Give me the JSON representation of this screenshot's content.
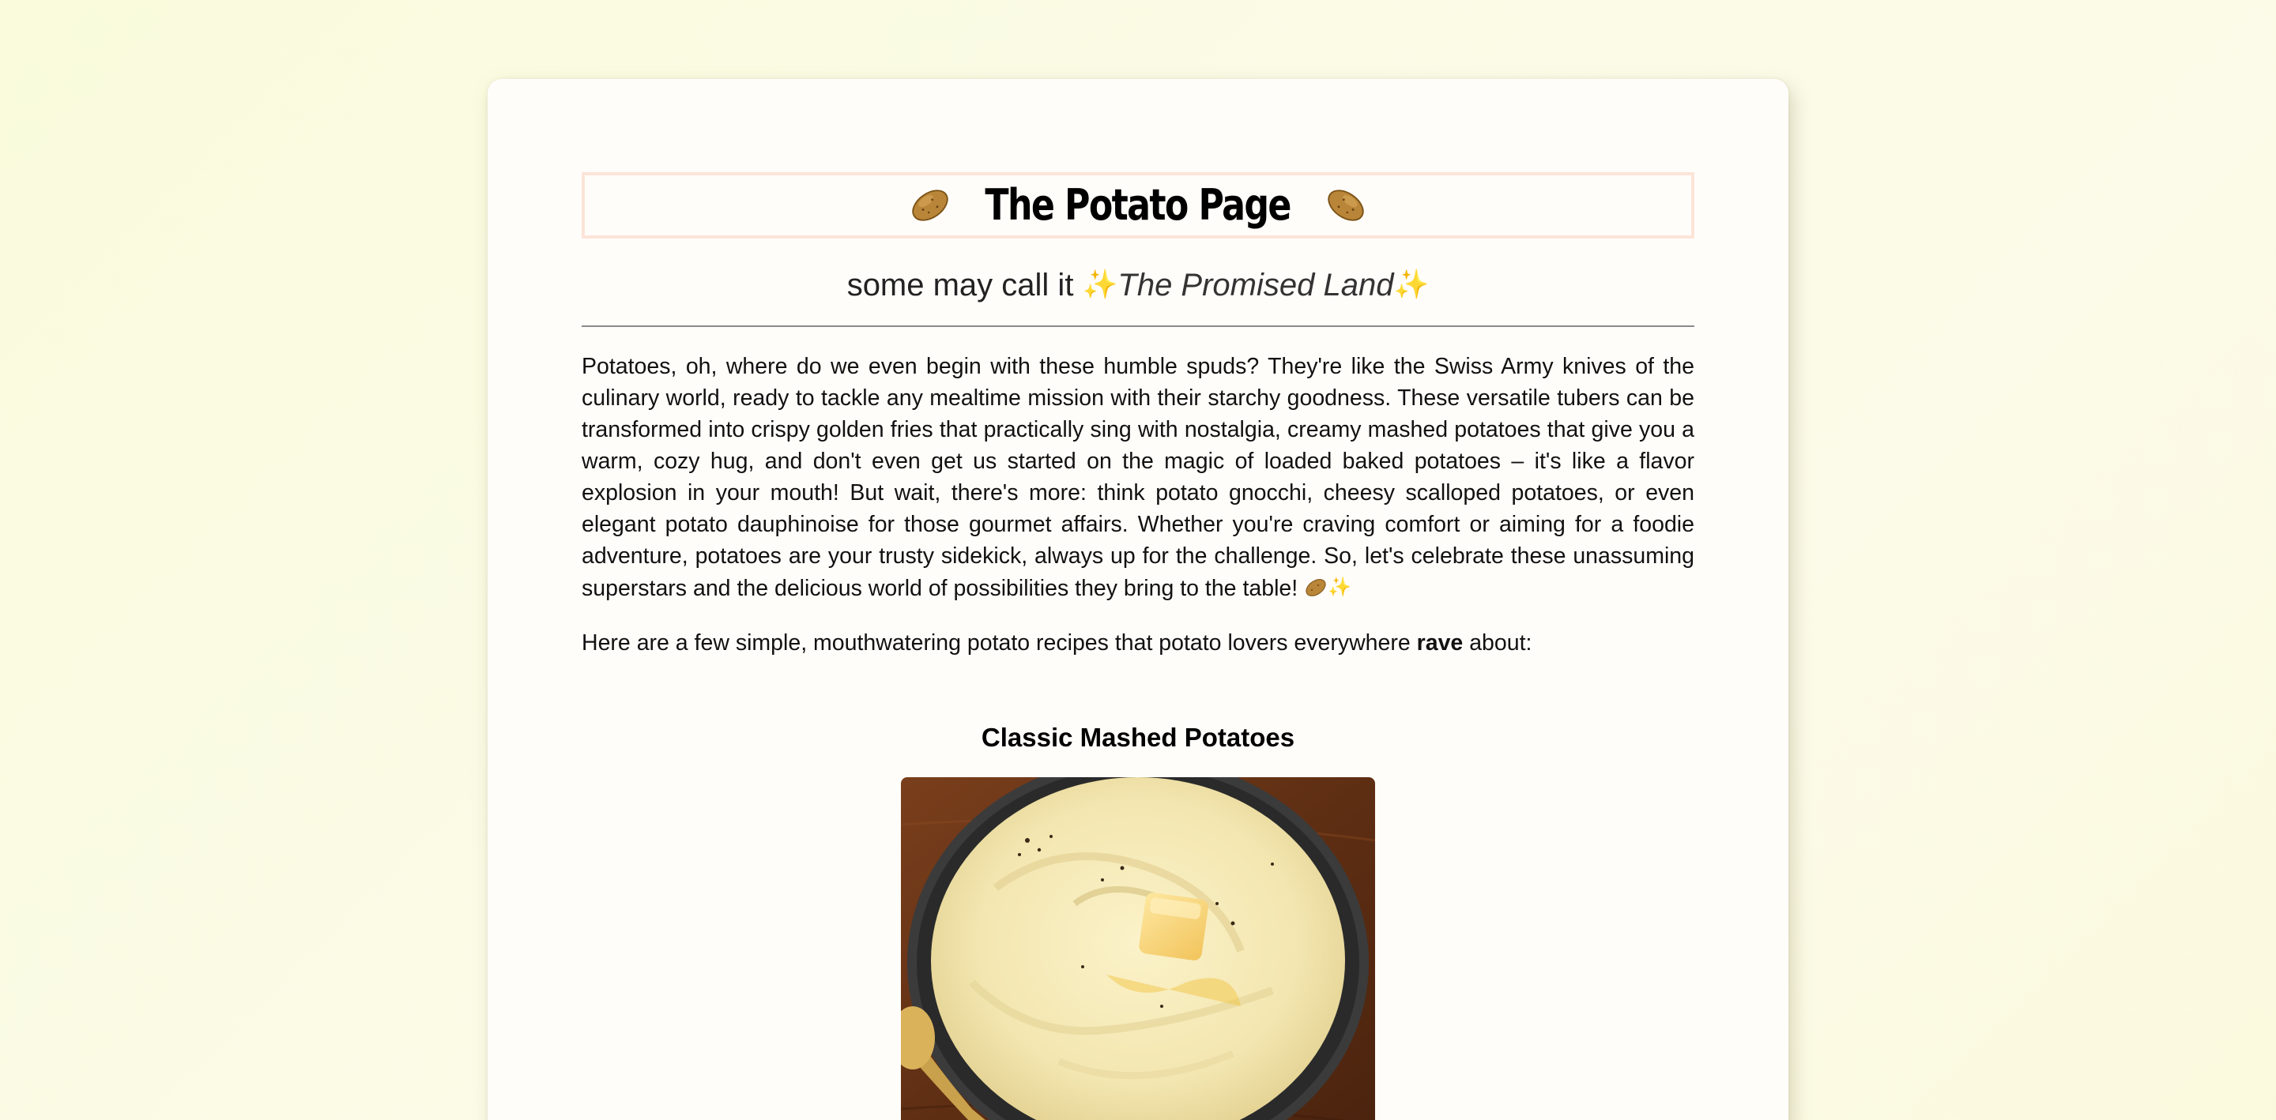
{
  "page": {
    "title": "The Potato Page",
    "subtitle_prefix": "some may call it",
    "subtitle_emphasis": "The Promised Land",
    "intro_paragraph": "Potatoes, oh, where do we even begin with these humble spuds? They're like the Swiss Army knives of the culinary world, ready to tackle any mealtime mission with their starchy goodness. These versatile tubers can be transformed into crispy golden fries that practically sing with nostalgia, creamy mashed potatoes that give you a warm, cozy hug, and don't even get us started on the magic of loaded baked potatoes – it's like a flavor explosion in your mouth! But wait, there's more: think potato gnocchi, cheesy scalloped potatoes, or even elegant potato dauphinoise for those gourmet affairs. Whether you're craving comfort or aiming for a foodie adventure, potatoes are your trusty sidekick, always up for the challenge. So, let's celebrate these unassuming superstars and the delicious world of possibilities they bring to the table!",
    "recipes_intro_before": "Here are a few simple, mouthwatering potato recipes that potato lovers everywhere",
    "recipes_intro_bold": "rave",
    "recipes_intro_after": "about:",
    "sparkle_glyph": "✨"
  },
  "recipes": [
    {
      "title": "Classic Mashed Potatoes",
      "image_icon": "mashed-potatoes-photo"
    }
  ],
  "colors": {
    "title_border": "#fde4d8",
    "card_background": "#fffdfa",
    "sparkle": "#f7c948"
  },
  "icons": {
    "title_left": "potato-icon",
    "title_right": "potato-icon",
    "paragraph_end": "potato-icon"
  }
}
